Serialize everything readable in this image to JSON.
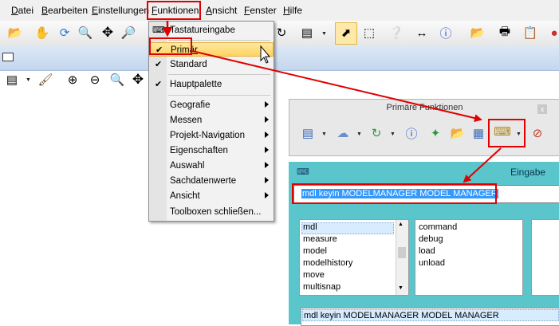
{
  "menubar": {
    "items": [
      {
        "mnemonic": "D",
        "rest": "atei"
      },
      {
        "mnemonic": "B",
        "rest": "earbeiten"
      },
      {
        "mnemonic": "E",
        "rest": "instellungen"
      },
      {
        "mnemonic": "F",
        "rest": "unktionen"
      },
      {
        "mnemonic": "A",
        "rest": "nsicht"
      },
      {
        "mnemonic": "F",
        "rest": "enster"
      },
      {
        "mnemonic": "H",
        "rest": "ilfe"
      }
    ]
  },
  "dropdown": {
    "tastatur": "Tastatureingabe",
    "primaer": "Primär",
    "standard": "Standard",
    "hauptpalette": "Hauptpalette",
    "submenus": [
      "Geografie",
      "Messen",
      "Projekt-Navigation",
      "Eigenschaften",
      "Auswahl",
      "Sachdatenwerte",
      "Ansicht"
    ],
    "close": "Toolboxen schließen..."
  },
  "primaere_panel": {
    "title": "Primäre Funktionen",
    "close_glyph": "x"
  },
  "eingabe_panel": {
    "title": "Eingabe",
    "command_value": "mdl keyin MODELMANAGER MODEL MANAGER",
    "history_value": "mdl keyin MODELMANAGER MODEL MANAGER",
    "list_left": [
      "mdl",
      "measure",
      "model",
      "modelhistory",
      "move",
      "multisnap"
    ],
    "list_right": [
      "command",
      "debug",
      "load",
      "unload"
    ]
  },
  "colors": {
    "highlight_red": "#e00000",
    "selection_blue": "#3399ff",
    "panel_teal": "#5ac6cc"
  }
}
